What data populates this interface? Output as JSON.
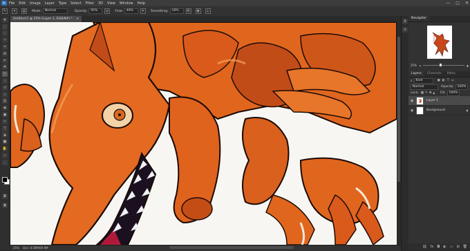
{
  "menubar": {
    "logo": "Ps",
    "items": [
      "File",
      "Edit",
      "Image",
      "Layer",
      "Type",
      "Select",
      "Filter",
      "3D",
      "View",
      "Window",
      "Help"
    ],
    "window_controls": [
      "—",
      "▢",
      "✕"
    ]
  },
  "options": {
    "mode_label": "Mode:",
    "mode_value": "Normal",
    "opacity_label": "Opacity:",
    "opacity_value": "95%",
    "flow_label": "Flow:",
    "flow_value": "40%",
    "smoothing_label": "Smoothing:",
    "smoothing_value": "10%"
  },
  "document": {
    "tab_title": "Untitled-2 @ 25% (Layer 1, RGB/8#) *",
    "tab_close": "×"
  },
  "status": {
    "zoom": "25%",
    "doc_info": "Doc: 8.58M/69.9M"
  },
  "navigator": {
    "tab": "Navigator",
    "zoom": "25%"
  },
  "layers_panel": {
    "tabs": [
      "Layers",
      "Channels",
      "Paths"
    ],
    "filter_kind": "Kind",
    "blend_mode": "Normal",
    "opacity_label": "Opacity:",
    "opacity_value": "100%",
    "lock_label": "Lock:",
    "fill_label": "Fill:",
    "fill_value": "100%",
    "layers": [
      {
        "name": "Layer 1",
        "selected": true
      },
      {
        "name": "Background",
        "selected": false
      }
    ]
  },
  "colors": {
    "dragon_body": "#e0661e",
    "dragon_shadow": "#9b3518",
    "outline": "#1a0a05",
    "ui_dark": "#323232"
  }
}
